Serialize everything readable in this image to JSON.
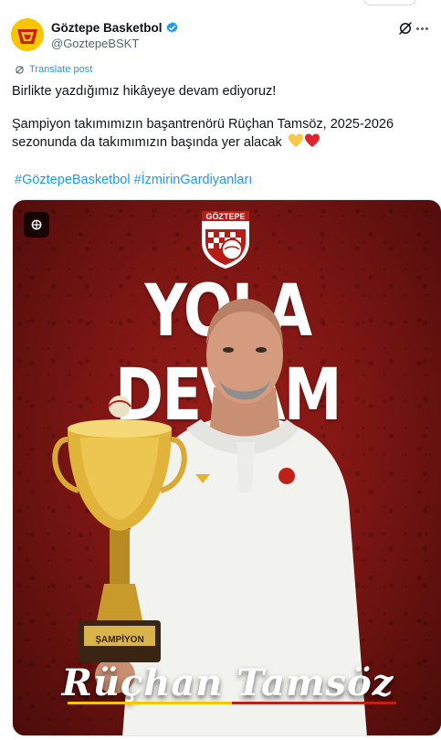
{
  "post": {
    "display_name": "Göztepe Basketbol",
    "handle": "@GoztepeBSKT",
    "translate_label": "Translate post",
    "text_line1": "Birlikte yazdığımız hikâyeye devam ediyoruz!",
    "text_line2": "Şampiyon takımımızın başantrenörü Rüçhan Tamsöz, 2025-2026",
    "text_line3": "sezonunda da takımımızın başında yer alacak",
    "hashtag1": "#GöztepeBasketbol",
    "hashtag2": "#İzmirinGardiyanları"
  },
  "media": {
    "crest_text": "GÖZTEPE",
    "headline": "YOLA DEVAM",
    "coach_name": "Rüçhan Tamsöz",
    "trophy_plate": "ŞAMPİYON"
  },
  "colors": {
    "accent": "#1d9bf0",
    "brand_red": "#8e1a16",
    "brand_yellow": "#f7c600"
  },
  "icons": [
    "verified-badge-icon",
    "grok-icon",
    "more-icon",
    "translate-icon",
    "grok-image-badge-icon",
    "heart-yellow-icon",
    "heart-red-icon"
  ]
}
